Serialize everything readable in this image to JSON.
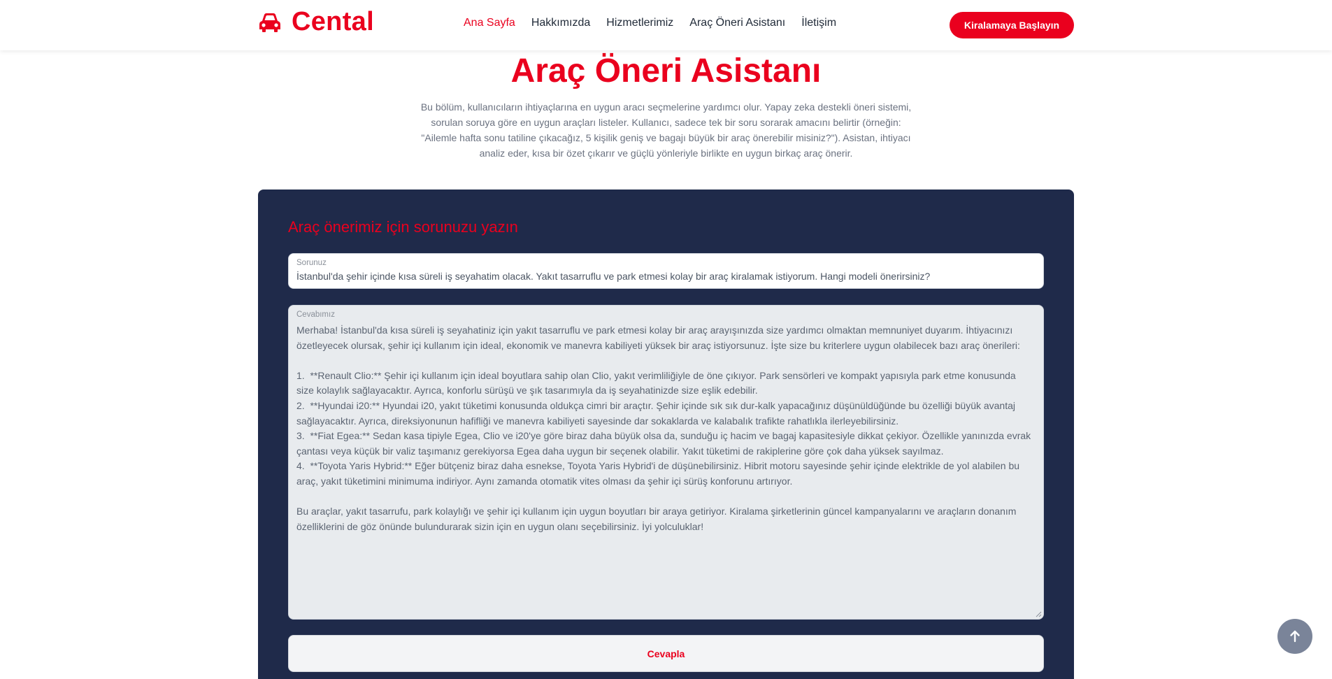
{
  "brand": {
    "name": "Cental",
    "icon": "car-icon",
    "color": "#ea001e"
  },
  "nav": {
    "items": [
      {
        "label": "Ana Sayfa",
        "active": true
      },
      {
        "label": "Hakkımızda",
        "active": false
      },
      {
        "label": "Hizmetlerimiz",
        "active": false
      },
      {
        "label": "Araç Öneri Asistanı",
        "active": false
      },
      {
        "label": "İletişim",
        "active": false
      }
    ],
    "cta_label": "Kiralamaya Başlayın"
  },
  "hero": {
    "title": "Araç Öneri Asistanı",
    "description": "Bu bölüm, kullanıcıların ihtiyaçlarına en uygun aracı seçmelerine yardımcı olur. Yapay zeka destekli öneri sistemi, sorulan soruya göre en uygun araçları listeler. Kullanıcı, sadece tek bir soru sorarak amacını belirtir (örneğin: \"Ailemle hafta sonu tatiline çıkacağız, 5 kişilik geniş ve bagajı büyük bir araç önerebilir misiniz?\"). Asistan, ihtiyacı analiz eder, kısa bir özet çıkarır ve güçlü yönleriyle birlikte en uygun birkaç araç önerir."
  },
  "form": {
    "heading": "Araç önerimiz için sorunuzu yazın",
    "question_label": "Sorunuz",
    "question_value": "İstanbul'da şehir içinde kısa süreli iş seyahatim olacak. Yakıt tasarruflu ve park etmesi kolay bir araç kiralamak istiyorum. Hangi modeli önerirsiniz?",
    "answer_label": "Cevabımız",
    "answer_value": "Merhaba! İstanbul'da kısa süreli iş seyahatiniz için yakıt tasarruflu ve park etmesi kolay bir araç arayışınızda size yardımcı olmaktan memnuniyet duyarım. İhtiyacınızı özetleyecek olursak, şehir içi kullanım için ideal, ekonomik ve manevra kabiliyeti yüksek bir araç istiyorsunuz. İşte size bu kriterlere uygun olabilecek bazı araç önerileri:\n\n1.  **Renault Clio:** Şehir içi kullanım için ideal boyutlara sahip olan Clio, yakıt verimliliğiyle de öne çıkıyor. Park sensörleri ve kompakt yapısıyla park etme konusunda size kolaylık sağlayacaktır. Ayrıca, konforlu sürüşü ve şık tasarımıyla da iş seyahatinizde size eşlik edebilir.\n2.  **Hyundai i20:** Hyundai i20, yakıt tüketimi konusunda oldukça cimri bir araçtır. Şehir içinde sık sık dur-kalk yapacağınız düşünüldüğünde bu özelliği büyük avantaj sağlayacaktır. Ayrıca, direksiyonunun hafifliği ve manevra kabiliyeti sayesinde dar sokaklarda ve kalabalık trafikte rahatlıkla ilerleyebilirsiniz.\n3.  **Fiat Egea:** Sedan kasa tipiyle Egea, Clio ve i20'ye göre biraz daha büyük olsa da, sunduğu iç hacim ve bagaj kapasitesiyle dikkat çekiyor. Özellikle yanınızda evrak çantası veya küçük bir valiz taşımanız gerekiyorsa Egea daha uygun bir seçenek olabilir. Yakıt tüketimi de rakiplerine göre çok daha yüksek sayılmaz.\n4.  **Toyota Yaris Hybrid:** Eğer bütçeniz biraz daha esnekse, Toyota Yaris Hybrid'i de düşünebilirsiniz. Hibrit motoru sayesinde şehir içinde elektrikle de yol alabilen bu araç, yakıt tüketimini minimuma indiriyor. Aynı zamanda otomatik vites olması da şehir içi sürüş konforunu artırıyor.\n\nBu araçlar, yakıt tasarrufu, park kolaylığı ve şehir içi kullanım için uygun boyutları bir araya getiriyor. Kiralama şirketlerinin güncel kampanyalarını ve araçların donanım özelliklerini de göz önünde bulundurarak sizin için en uygun olanı seçebilirsiniz. İyi yolculuklar!",
    "submit_label": "Cevapla"
  },
  "back_to_top": {
    "icon": "arrow-up-icon"
  },
  "colors": {
    "accent": "#ea001e",
    "panel": "#1f2a4a",
    "back_top": "#7a8499"
  }
}
